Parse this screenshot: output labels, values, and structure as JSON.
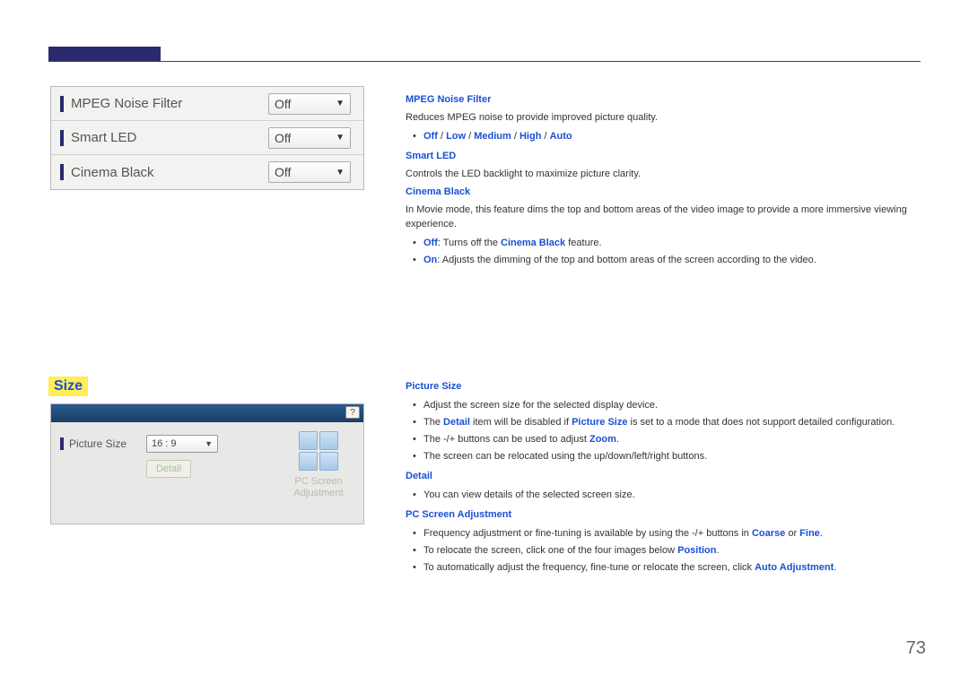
{
  "page_number": "73",
  "panel1": {
    "rows": [
      {
        "label": "MPEG Noise Filter",
        "value": "Off"
      },
      {
        "label": "Smart LED",
        "value": "Off"
      },
      {
        "label": "Cinema Black",
        "value": "Off"
      }
    ]
  },
  "top_text": {
    "h1": "MPEG Noise Filter",
    "p1": "Reduces MPEG noise to provide improved picture quality.",
    "opt_off": "Off",
    "opt_low": "Low",
    "opt_medium": "Medium",
    "opt_high": "High",
    "opt_auto": "Auto",
    "sep": " / ",
    "h2": "Smart LED",
    "p2": "Controls the LED backlight to maximize picture clarity.",
    "h3": "Cinema Black",
    "p3": "In Movie mode, this feature dims the top and bottom areas of the video image to provide a more immersive viewing experience.",
    "b1_bold": "Off",
    "b1_rest": ": Turns off the ",
    "b1_bold2": "Cinema Black",
    "b1_rest2": " feature.",
    "b2_bold": "On",
    "b2_rest": ": Adjusts the dimming of the top and bottom areas of the screen according to the video."
  },
  "size_heading": "Size",
  "panel2": {
    "help": "?",
    "label": "Picture Size",
    "value": "16 : 9",
    "detail": "Detail",
    "pc1": "PC Screen",
    "pc2": "Adjustment"
  },
  "bottom_text": {
    "h1": "Picture Size",
    "b1": "Adjust the screen size for the selected display device.",
    "b2a": "The ",
    "b2b": "Detail",
    "b2c": " item will be disabled if ",
    "b2d": "Picture Size",
    "b2e": " is set to a mode that does not support detailed configuration.",
    "b3a": "The -/+ buttons can be used to adjust ",
    "b3b": "Zoom",
    "b3c": ".",
    "b4": "The screen can be relocated using the up/down/left/right buttons.",
    "h2": "Detail",
    "b5": "You can view details of the selected screen size.",
    "h3": "PC Screen Adjustment",
    "b6a": "Frequency adjustment or fine-tuning is available by using the -/+ buttons in ",
    "b6b": "Coarse",
    "b6c": " or ",
    "b6d": "Fine",
    "b6e": ".",
    "b7a": "To relocate the screen, click one of the four images below ",
    "b7b": "Position",
    "b7c": ".",
    "b8a": "To automatically adjust the frequency, fine-tune or relocate the screen, click ",
    "b8b": "Auto Adjustment",
    "b8c": "."
  }
}
